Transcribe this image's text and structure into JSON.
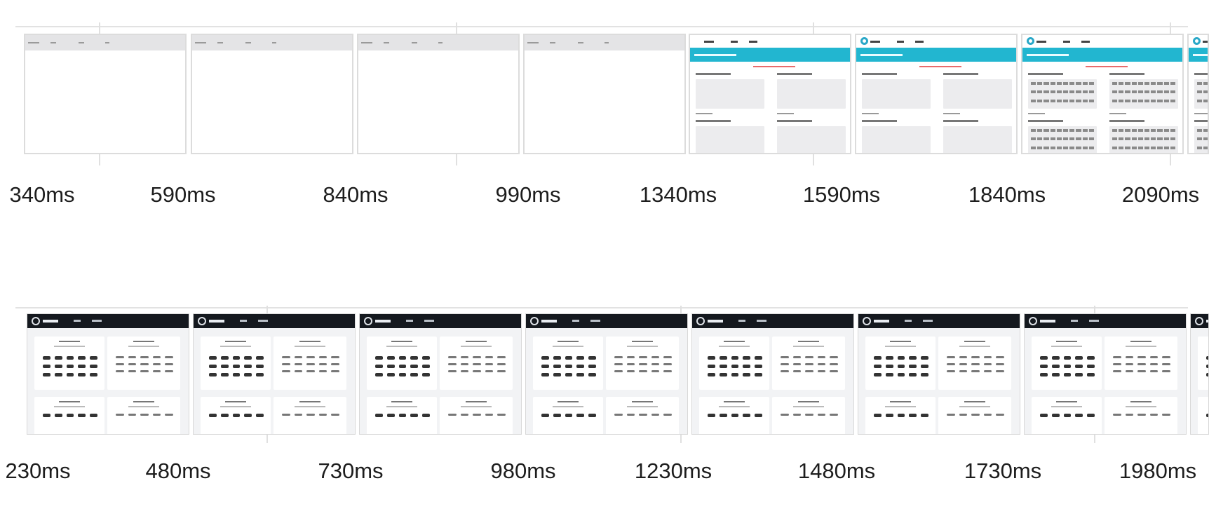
{
  "top_filmstrip": {
    "frames": [
      {
        "time_label": "340ms",
        "state": "blank"
      },
      {
        "time_label": "590ms",
        "state": "blank"
      },
      {
        "time_label": "840ms",
        "state": "blank"
      },
      {
        "time_label": "990ms",
        "state": "blank"
      },
      {
        "time_label": "1340ms",
        "state": "rendered"
      },
      {
        "time_label": "1590ms",
        "state": "rendered"
      },
      {
        "time_label": "1840ms",
        "state": "rendered"
      },
      {
        "time_label": "2090ms",
        "state": "rendered"
      }
    ],
    "accent_color": "#22b6d0"
  },
  "bottom_filmstrip": {
    "frames": [
      {
        "time_label": "230ms",
        "state": "rendered"
      },
      {
        "time_label": "480ms",
        "state": "rendered"
      },
      {
        "time_label": "730ms",
        "state": "rendered"
      },
      {
        "time_label": "980ms",
        "state": "rendered"
      },
      {
        "time_label": "1230ms",
        "state": "rendered"
      },
      {
        "time_label": "1480ms",
        "state": "rendered"
      },
      {
        "time_label": "1730ms",
        "state": "rendered"
      },
      {
        "time_label": "1980ms",
        "state": "rendered"
      }
    ],
    "header_color": "#15191f"
  }
}
